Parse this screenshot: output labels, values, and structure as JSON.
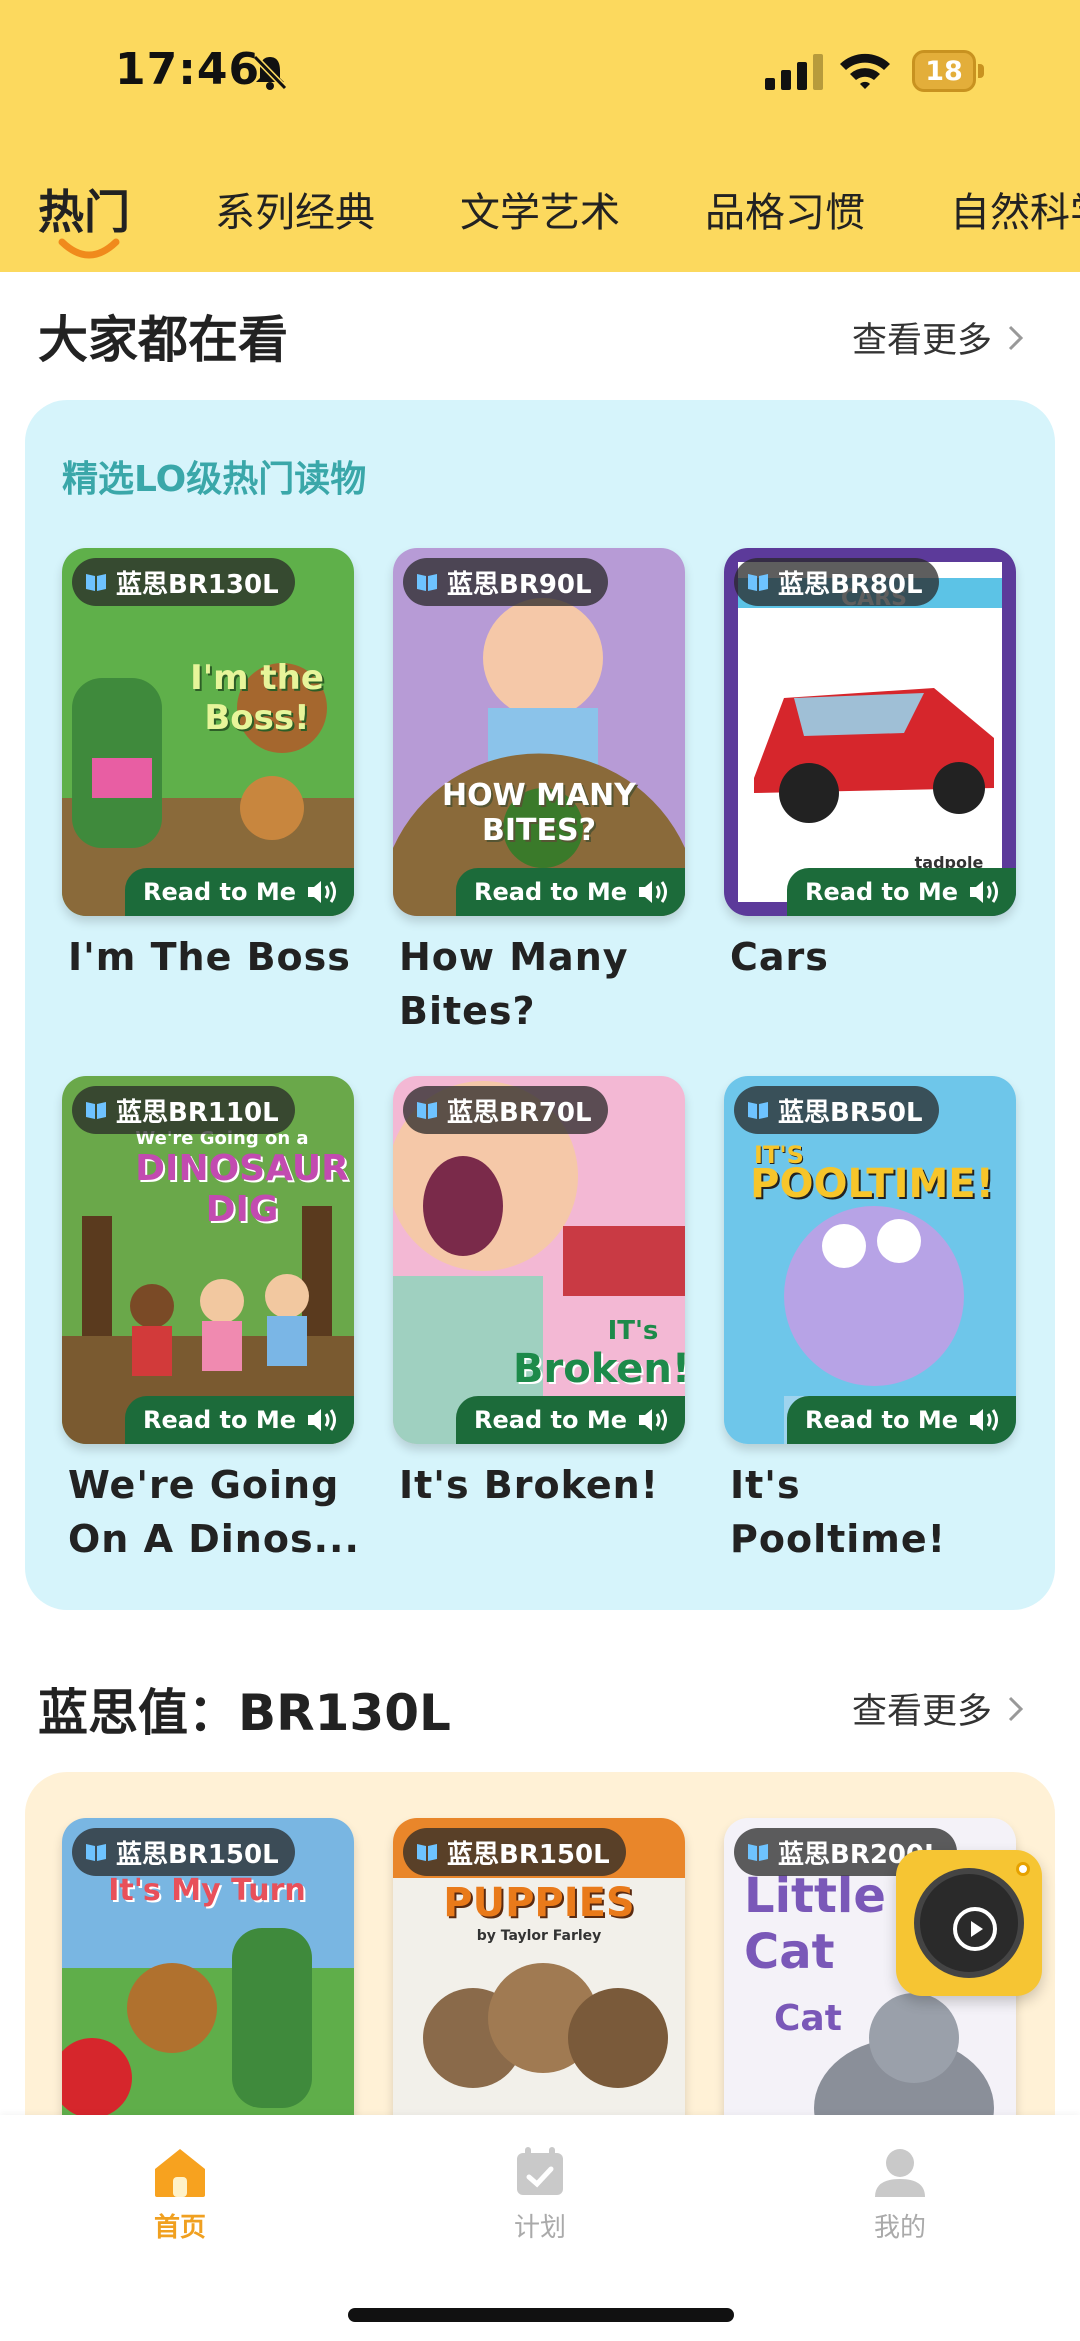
{
  "status_bar": {
    "time": "17:46",
    "battery": "18"
  },
  "tabs": [
    "热门",
    "系列经典",
    "文学艺术",
    "品格习惯",
    "自然科学"
  ],
  "section1": {
    "title": "大家都在看",
    "more": "查看更多",
    "panel_title": "精选LO级热门读物",
    "books": [
      {
        "level": "蓝思BR130L",
        "title": "I'm The Boss",
        "read_label": "Read to Me",
        "cover_text": "I'm the Boss!"
      },
      {
        "level": "蓝思BR90L",
        "title": "How Many Bites?",
        "read_label": "Read to Me",
        "cover_text": "HOW MANY BITES?"
      },
      {
        "level": "蓝思BR80L",
        "title": "Cars",
        "read_label": "Read to Me",
        "cover_text": "CARS",
        "cover_small": "tadpole"
      },
      {
        "level": "蓝思BR110L",
        "title": "We're Going On A Dinos...",
        "read_label": "Read to Me",
        "cover_text": "DINOSAUR DIG",
        "cover_small": "We're Going on a"
      },
      {
        "level": "蓝思BR70L",
        "title": "It's Broken!",
        "read_label": "Read to Me",
        "cover_text": "Broken!",
        "cover_small": "IT's"
      },
      {
        "level": "蓝思BR50L",
        "title": "It's Pooltime!",
        "read_label": "Read to Me",
        "cover_text": "POOLTIME!",
        "cover_small": "IT'S"
      }
    ]
  },
  "section2": {
    "title": "蓝思值：BR130L",
    "more": "查看更多",
    "books": [
      {
        "level": "蓝思BR150L",
        "cover_text": "It's My Turn"
      },
      {
        "level": "蓝思BR150L",
        "cover_text": "PUPPIES",
        "cover_small": "by Taylor Farley"
      },
      {
        "level": "蓝思BR200L",
        "cover_text": "Little Cat",
        "cover_small": "Cat"
      }
    ]
  },
  "nav": {
    "home": "首页",
    "plan": "计划",
    "mine": "我的"
  },
  "colors": {
    "header": "#fcd95e",
    "accent": "#f0a020",
    "panel1": "#d6f4fb",
    "panel2": "#fff1d6",
    "read_badge": "#1c6b3a"
  }
}
